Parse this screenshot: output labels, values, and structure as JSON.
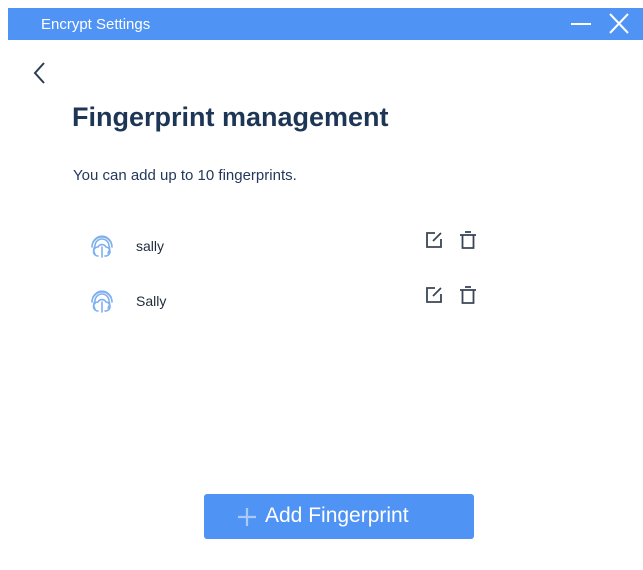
{
  "window": {
    "title": "Encrypt Settings"
  },
  "page": {
    "heading": "Fingerprint management",
    "subtitle": "You can add up to 10 fingerprints."
  },
  "fingerprints": [
    {
      "name": "sally"
    },
    {
      "name": "Sally"
    }
  ],
  "actions": {
    "add_label": "Add Fingerprint"
  },
  "icons": {
    "back": "chevron-left-icon",
    "minimize": "minimize-icon",
    "close": "close-icon",
    "fingerprint": "fingerprint-icon",
    "edit": "edit-icon",
    "delete": "trash-icon",
    "add": "plus-icon"
  },
  "colors": {
    "accent": "#4f94f5",
    "heading": "#1e3656",
    "fingerprint_icon": "#7fb0ee"
  }
}
